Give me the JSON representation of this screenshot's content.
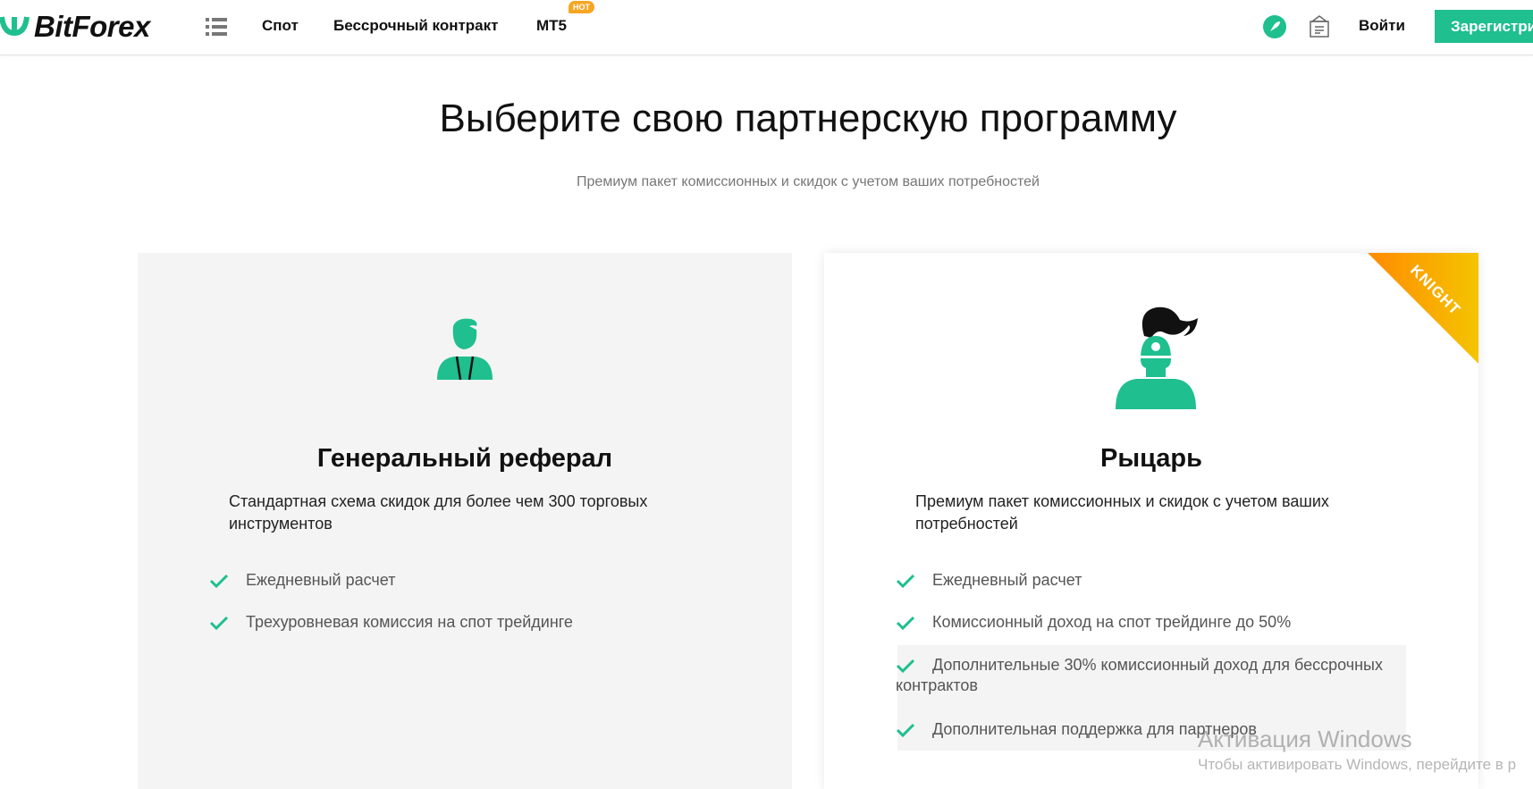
{
  "header": {
    "brand": "BitForex",
    "nav": [
      "Спот",
      "Бессрочный контракт",
      "MT5"
    ],
    "hot_badge": "HOT",
    "login": "Войти",
    "register": "Зарегистри"
  },
  "page": {
    "title": "Выберите свою партнерскую программу",
    "subtitle": "Премиум пакет комиссионных и скидок с учетом ваших потребностей"
  },
  "cards": [
    {
      "title": "Генеральный реферал",
      "description": "Стандартная схема скидок для более чем 300 торговых инструментов",
      "features": [
        "Ежедневный расчет",
        "Трехуровневая комиссия на спот трейдинге"
      ]
    },
    {
      "title": "Рыцарь",
      "badge": "KNIGHT",
      "description": "Премиум пакет комиссионных и скидок с учетом ваших потребностей",
      "features": [
        "Ежедневный расчет",
        "Комиссионный доход на спот трейдинге до 50%",
        "Дополнительные 30% комиссионный доход для бессрочных контрактов",
        "Дополнительная поддержка для партнеров"
      ]
    }
  ],
  "watermark": {
    "line1": "Активация Windows",
    "line2": "Чтобы активировать Windows, перейдите в р"
  },
  "colors": {
    "accent": "#1fbf8f",
    "ribbon": "#ff8a00"
  }
}
